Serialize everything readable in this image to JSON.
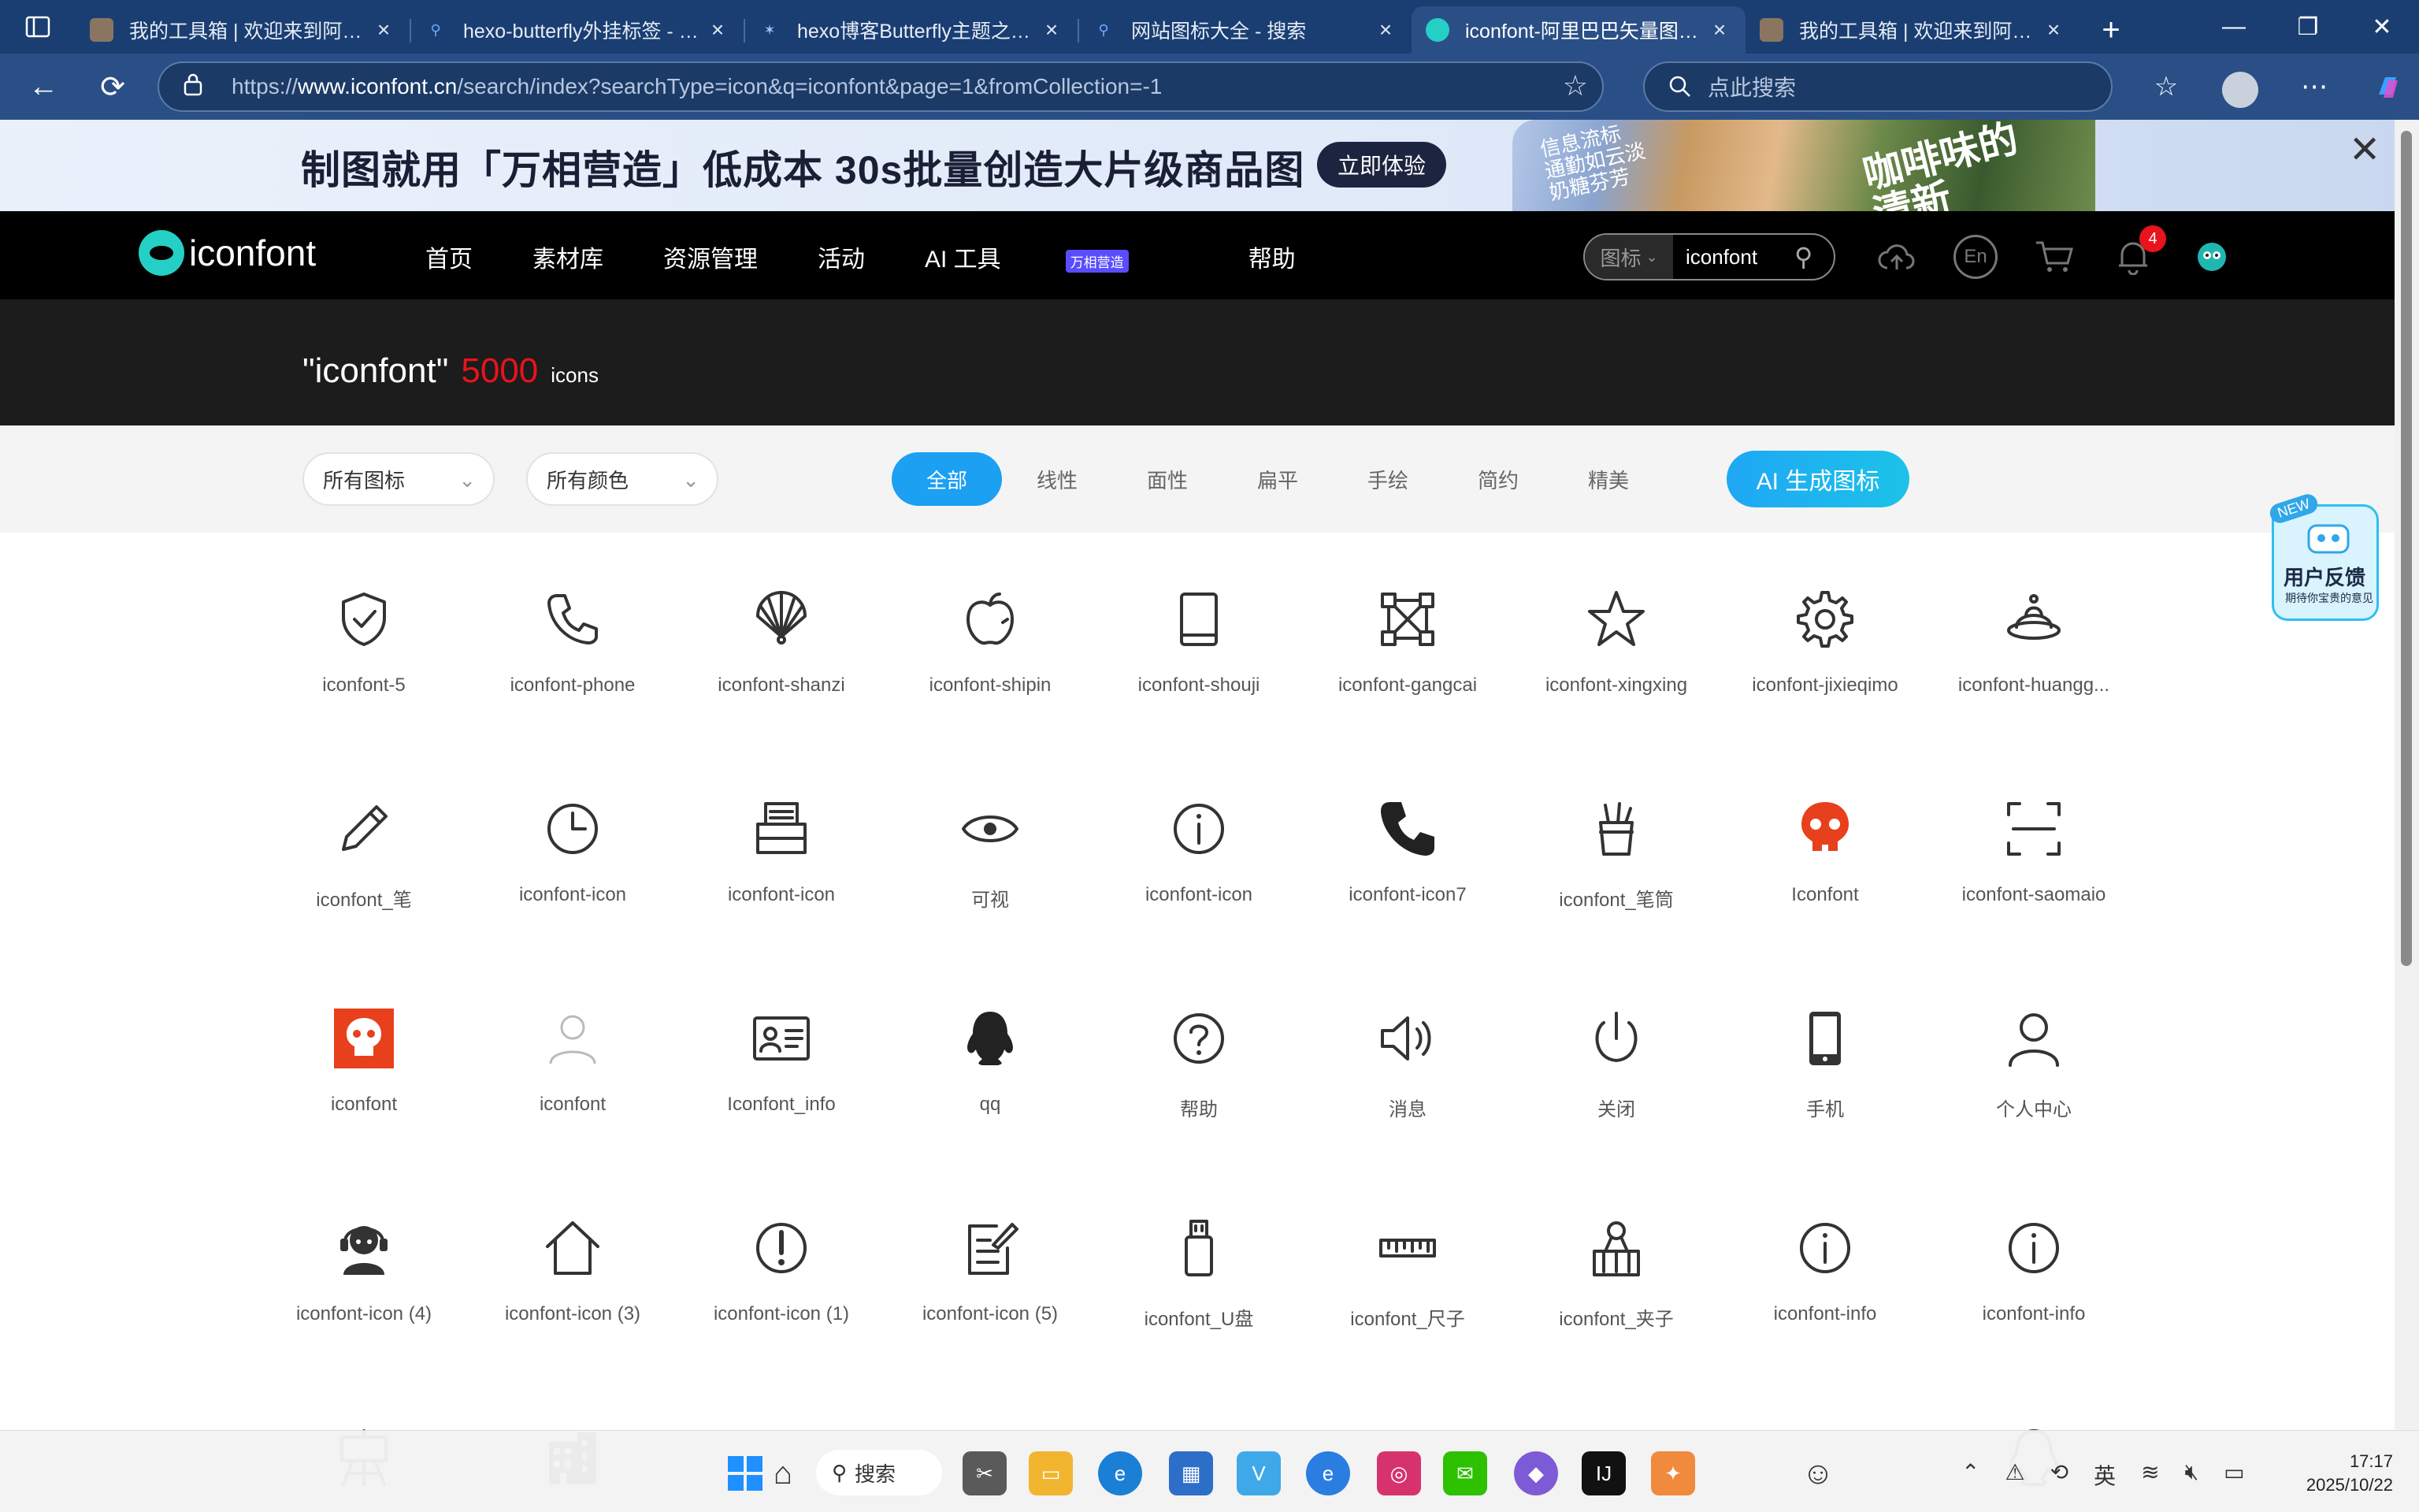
{
  "browser": {
    "tabs": [
      {
        "title": "我的工具箱 | 欢迎来到阿叶A",
        "favicon": "avatar-photo-icon"
      },
      {
        "title": "hexo-butterfly外挂标签 - 搜索",
        "favicon": "search-icon"
      },
      {
        "title": "hexo博客Butterfly主题之标签",
        "favicon": "butterfly-icon"
      },
      {
        "title": "网站图标大全 - 搜索",
        "favicon": "search-icon"
      },
      {
        "title": "iconfont-阿里巴巴矢量图标库",
        "favicon": "iconfont-logo-icon",
        "active": true
      },
      {
        "title": "我的工具箱 | 欢迎来到阿叶A",
        "favicon": "avatar-photo-icon"
      }
    ],
    "url_prefix": "https://",
    "url_domain": "www.iconfont.cn",
    "url_path": "/search/index?searchType=icon&q=iconfont&page=1&fromCollection=-1",
    "side_search_placeholder": "点此搜索"
  },
  "banner": {
    "text": "制图就用「万相营造」低成本 30s批量创造大片级商品图",
    "button": "立即体验",
    "img_text_1": "信息流标\n通勤如云淡\n奶糖芬芳",
    "img_text_2": "咖啡味的\n清新"
  },
  "site": {
    "logo_text": "iconfont",
    "nav": [
      "首页",
      "素材库",
      "资源管理",
      "活动",
      "AI 工具",
      "帮助"
    ],
    "ai_badge": "万相营造",
    "search_type": "图标",
    "search_query": "iconfont",
    "lang": "En",
    "notification_count": "4"
  },
  "results": {
    "query_quoted": "\"iconfont\"",
    "count": "5000",
    "unit": "icons"
  },
  "filters": {
    "all_icons": "所有图标",
    "all_colors": "所有颜色",
    "styles": [
      "全部",
      "线性",
      "面性",
      "扁平",
      "手绘",
      "简约",
      "精美"
    ],
    "active_style": "全部",
    "ai_button": "AI 生成图标"
  },
  "feedback": {
    "badge": "NEW",
    "title": "用户反馈",
    "subtitle": "期待你宝贵的意见"
  },
  "icons": [
    {
      "label": "iconfont-5",
      "icon": "shield-check-icon"
    },
    {
      "label": "iconfont-phone",
      "icon": "phone-icon"
    },
    {
      "label": "iconfont-shanzi",
      "icon": "fan-icon"
    },
    {
      "label": "iconfont-shipin",
      "icon": "apple-icon"
    },
    {
      "label": "iconfont-shouji",
      "icon": "tablet-icon"
    },
    {
      "label": "iconfont-gangcai",
      "icon": "steel-frame-icon"
    },
    {
      "label": "iconfont-xingxing",
      "icon": "star-icon"
    },
    {
      "label": "iconfont-jixieqimo",
      "icon": "gear-icon"
    },
    {
      "label": "iconfont-huangg...",
      "icon": "crown-hat-icon"
    },
    {
      "label": "iconfont_笔",
      "icon": "pen-icon"
    },
    {
      "label": "iconfont-icon",
      "icon": "clock-icon"
    },
    {
      "label": "iconfont-icon",
      "icon": "printer-icon"
    },
    {
      "label": "可视",
      "icon": "eye-icon"
    },
    {
      "label": "iconfont-icon",
      "icon": "info-circle-icon"
    },
    {
      "label": "iconfont-icon7",
      "icon": "phone-filled-icon"
    },
    {
      "label": "iconfont_笔筒",
      "icon": "pen-holder-icon"
    },
    {
      "label": "Iconfont",
      "icon": "skull-red-icon"
    },
    {
      "label": "iconfont-saomaio",
      "icon": "scan-icon"
    },
    {
      "label": "iconfont",
      "icon": "skull-square-red-icon"
    },
    {
      "label": "iconfont",
      "icon": "user-light-icon"
    },
    {
      "label": "Iconfont_info",
      "icon": "id-card-icon"
    },
    {
      "label": "qq",
      "icon": "penguin-icon"
    },
    {
      "label": "帮助",
      "icon": "question-circle-icon"
    },
    {
      "label": "消息",
      "icon": "speaker-icon"
    },
    {
      "label": "关闭",
      "icon": "power-icon"
    },
    {
      "label": "手机",
      "icon": "mobile-icon"
    },
    {
      "label": "个人中心",
      "icon": "user-outline-icon"
    },
    {
      "label": "iconfont-icon (4)",
      "icon": "headset-user-icon"
    },
    {
      "label": "iconfont-icon (3)",
      "icon": "home-icon"
    },
    {
      "label": "iconfont-icon (1)",
      "icon": "exclamation-circle-icon"
    },
    {
      "label": "iconfont-icon (5)",
      "icon": "edit-doc-icon"
    },
    {
      "label": "iconfont_U盘",
      "icon": "usb-drive-icon"
    },
    {
      "label": "iconfont_尺子",
      "icon": "ruler-icon"
    },
    {
      "label": "iconfont_夹子",
      "icon": "clip-icon"
    },
    {
      "label": "iconfont-info",
      "icon": "info-circle-icon"
    },
    {
      "label": "iconfont-info",
      "icon": "info-circle-icon"
    },
    {
      "label": "",
      "icon": "easel-icon"
    },
    {
      "label": "",
      "icon": "building-icon"
    },
    {
      "label": "",
      "icon": "qq-outline-icon"
    }
  ],
  "taskbar": {
    "search_label": "搜索",
    "ime": "英",
    "time": "17:17",
    "date": "2025/10/22"
  },
  "colors": {
    "tab_bg": "#1a3e72",
    "accent": "#1ba0f2",
    "count_red": "#e8131c"
  }
}
